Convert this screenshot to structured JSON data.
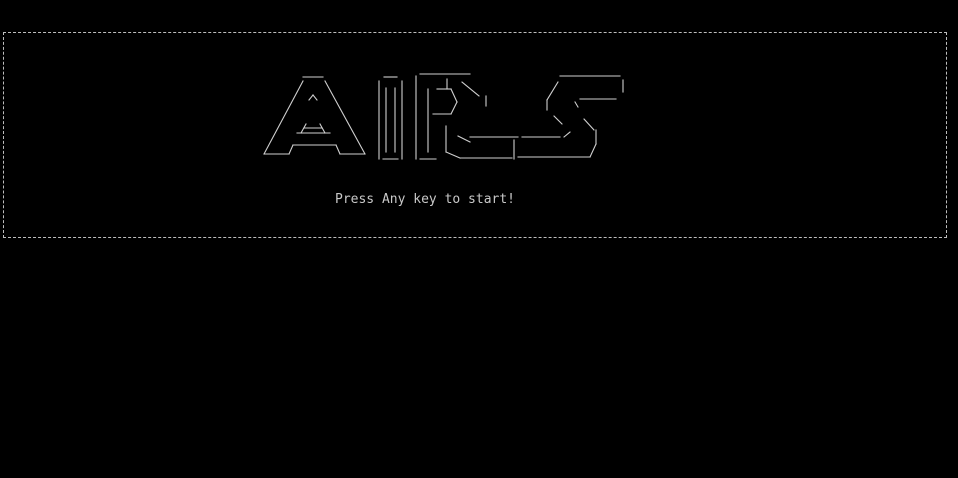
{
  "logo": {
    "text": "AIRS",
    "style": "ascii-art"
  },
  "prompt": {
    "text": "Press Any key to start!"
  },
  "colors": {
    "background": "#000000",
    "foreground": "#c0c0c0",
    "border": "#bdbdbd"
  }
}
